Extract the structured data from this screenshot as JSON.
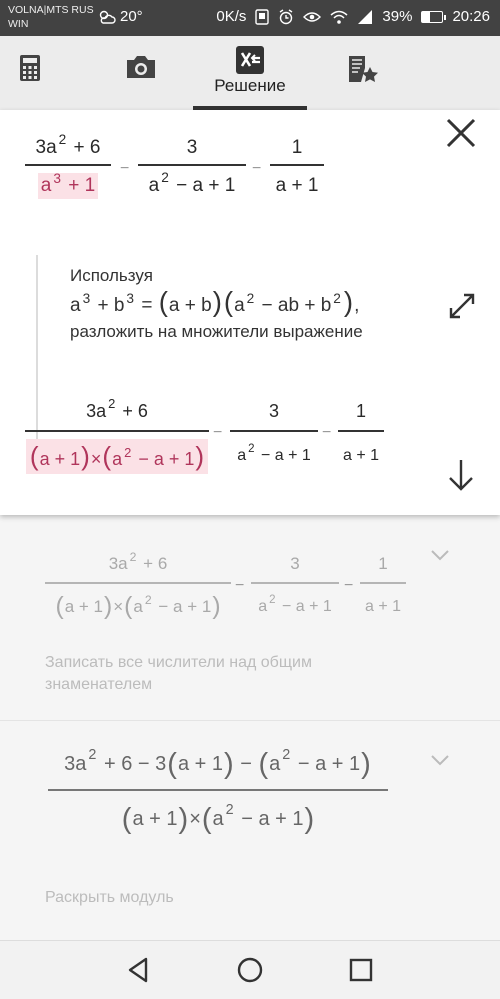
{
  "status_bar": {
    "carrier_line1": "VOLNA|MTS RUS",
    "carrier_line2": "WIN",
    "temperature": "20°",
    "speed": "0K/s",
    "battery": "39%",
    "battery_level": 0.39,
    "time": "20:26"
  },
  "toolbar": {
    "tabs": [
      {
        "name": "calculator-icon",
        "label": ""
      },
      {
        "name": "camera-icon",
        "label": ""
      },
      {
        "name": "solution-icon",
        "label": "Решение",
        "active": true
      },
      {
        "name": "saved-notes-icon",
        "label": ""
      }
    ]
  },
  "current_step": {
    "expr1": {
      "f1_num": "3a",
      "f1_num_exp": "2",
      "f1_num_rest": "+ 6",
      "f1_den": "a",
      "f1_den_exp": "3",
      "f1_den_rest": "+ 1",
      "op1": "−",
      "f2_num": "3",
      "f2_den": "a",
      "f2_den_exp": "2",
      "f2_den_rest": "− a + 1",
      "op2": "−",
      "f3_num": "1",
      "f3_den": "a + 1"
    },
    "explanation": {
      "line1": "Используя",
      "formula_a": "a",
      "formula_a_exp": "3",
      "formula_plus": "+ b",
      "formula_b_exp": "3",
      "formula_eq": "=",
      "formula_f1": "a + b",
      "formula_a2": "a",
      "formula_a2_exp": "2",
      "formula_mid": "− ab + b",
      "formula_b2_exp": "2",
      "formula_end": ",",
      "line3": "разложить на множители выражение"
    },
    "expr2": {
      "f1_num": "3a",
      "f1_num_exp": "2",
      "f1_num_rest": "+ 6",
      "f1_den_a": "a + 1",
      "times": "×",
      "f1_den_b": "a",
      "f1_den_b_exp": "2",
      "f1_den_b_rest": "− a + 1",
      "op1": "−",
      "f2_num": "3",
      "f2_den": "a",
      "f2_den_exp": "2",
      "f2_den_rest": "− a + 1",
      "op2": "−",
      "f3_num": "1",
      "f3_den": "a + 1"
    }
  },
  "step2": {
    "f1_num": "3a",
    "f1_num_exp": "2",
    "f1_num_rest": "+ 6",
    "f1_den_a": "a + 1",
    "times": "×",
    "f1_den_b": "a",
    "f1_den_b_exp": "2",
    "f1_den_b_rest": "− a + 1",
    "op1": "−",
    "f2_num": "3",
    "f2_den": "a",
    "f2_den_exp": "2",
    "f2_den_rest": "− a + 1",
    "op2": "−",
    "f3_num": "1",
    "f3_den": "a + 1",
    "caption": "Записать все числители над общим знаменателем"
  },
  "step3": {
    "num_start": "3a",
    "num_exp": "2",
    "num_mid": "+ 6 − 3",
    "num_p1": "a + 1",
    "num_minus": "−",
    "num_p2a": "a",
    "num_p2_exp": "2",
    "num_p2_rest": "− a + 1",
    "den_a": "a + 1",
    "times": "×",
    "den_b": "a",
    "den_b_exp": "2",
    "den_b_rest": "− a + 1",
    "caption": "Раскрыть модуль"
  },
  "colors": {
    "highlight_bg": "#fbe1e6",
    "highlight_text": "#b0355b",
    "status_bar": "#424242",
    "toolbar": "#ececec"
  }
}
